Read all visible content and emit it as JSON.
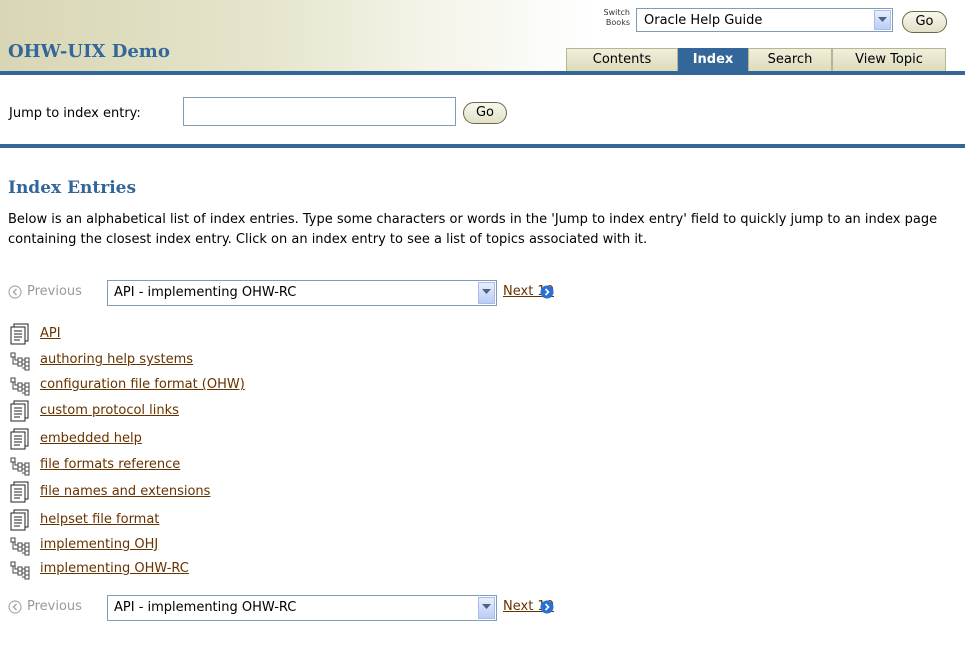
{
  "header": {
    "brand": "OHW-UIX Demo",
    "switch_books_label": "Switch Books",
    "book_select_value": "Oracle Help Guide",
    "go_label": "Go"
  },
  "tabs": [
    {
      "label": "Contents",
      "selected": false
    },
    {
      "label": "Index",
      "selected": true
    },
    {
      "label": "Search",
      "selected": false
    },
    {
      "label": "View Topic",
      "selected": false
    }
  ],
  "jump": {
    "label": "Jump to index entry:",
    "value": "",
    "go_label": "Go"
  },
  "index": {
    "title": "Index Entries",
    "description": "Below is an alphabetical list of index entries. Type some characters or words in the 'Jump to index entry' field to quickly jump to an index page containing the closest index entry. Click on an index entry to see a list of topics associated with it.",
    "previous_label": "Previous",
    "page_select_value": "API - implementing OHW-RC",
    "next_label": "Next 10",
    "entries": [
      {
        "label": "API",
        "icon": "topic-icon"
      },
      {
        "label": "authoring help systems",
        "icon": "subentries-icon"
      },
      {
        "label": "configuration file format (OHW)",
        "icon": "subentries-icon"
      },
      {
        "label": "custom protocol links",
        "icon": "topic-icon"
      },
      {
        "label": "embedded help",
        "icon": "topic-icon"
      },
      {
        "label": "file formats reference",
        "icon": "subentries-icon"
      },
      {
        "label": "file names and extensions",
        "icon": "topic-icon"
      },
      {
        "label": "helpset file format",
        "icon": "topic-icon"
      },
      {
        "label": "implementing OHJ",
        "icon": "subentries-icon"
      },
      {
        "label": "implementing OHW-RC",
        "icon": "subentries-icon"
      }
    ]
  },
  "colors": {
    "accent": "#336699",
    "link": "#663300",
    "disabled": "#999999"
  }
}
